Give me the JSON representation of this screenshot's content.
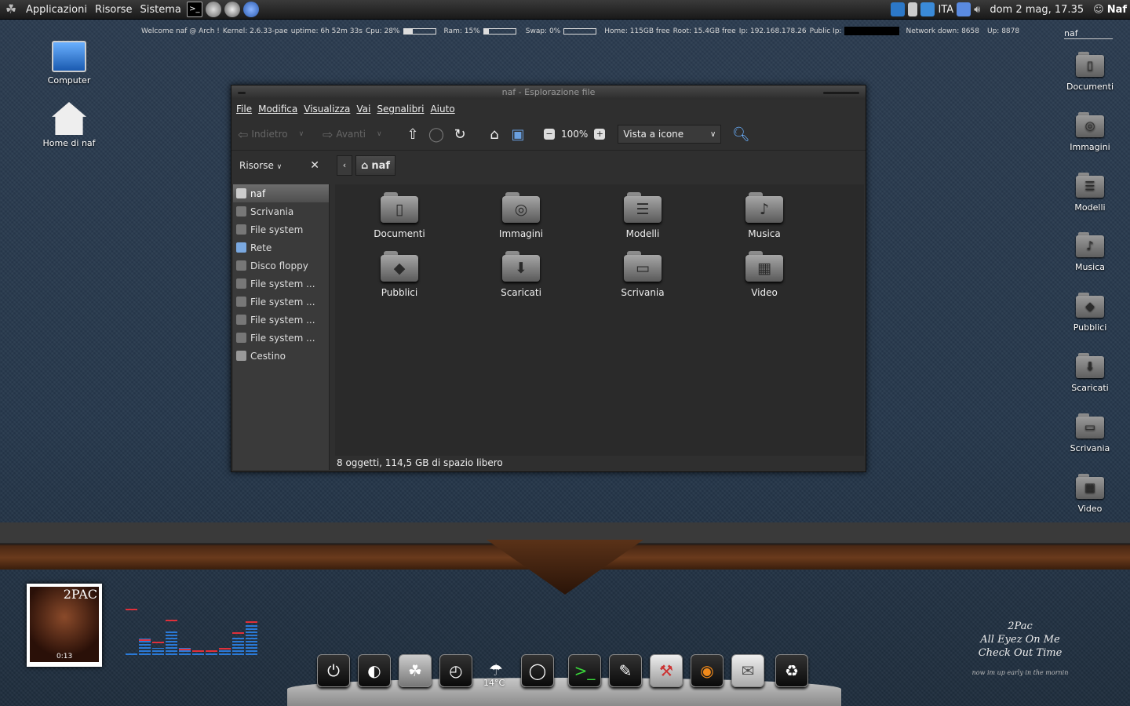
{
  "top_panel": {
    "menus": [
      "Applicazioni",
      "Risorse",
      "Sistema"
    ],
    "keyboard": "ITA",
    "clock": "dom  2 mag, 17.35",
    "user": "Naf"
  },
  "conky": {
    "welcome": "Welcome naf @ Arch !",
    "kernel": "Kernel: 2.6.33-pae",
    "uptime": "uptime: 6h 52m 33s",
    "cpu": "Cpu: 28%",
    "cpu_pct": 0.28,
    "ram": "Ram: 15%",
    "ram_pct": 0.15,
    "swap": "Swap: 0%",
    "swap_pct": 0,
    "home": "Home: 115GB free",
    "root": "Root: 15.4GB free",
    "ip": "Ip: 192.168.178.26",
    "public_ip": "Public Ip:",
    "net_down": "Network down: 8658",
    "net_up": "Up: 8878",
    "user_label": "naf"
  },
  "desktop": {
    "left_icons": [
      "Computer",
      "Home di naf"
    ],
    "right_icons": [
      "Documenti",
      "Immagini",
      "Modelli",
      "Musica",
      "Pubblici",
      "Scaricati",
      "Scrivania",
      "Video"
    ]
  },
  "window": {
    "title": "naf - Esplorazione file",
    "menu": [
      "File",
      "Modifica",
      "Visualizza",
      "Vai",
      "Segnalibri",
      "Aiuto"
    ],
    "toolbar": {
      "back": "Indietro",
      "forward": "Avanti",
      "zoom": "100%",
      "view": "Vista a icone"
    },
    "sidebar_header": "Risorse",
    "breadcrumb": "naf",
    "sidebar_items": [
      "naf",
      "Scrivania",
      "File system",
      "Rete",
      "Disco floppy",
      "File system ...",
      "File system ...",
      "File system ...",
      "File system ...",
      "Cestino"
    ],
    "files": [
      "Documenti",
      "Immagini",
      "Modelli",
      "Musica",
      "Pubblici",
      "Scaricati",
      "Scrivania",
      "Video"
    ],
    "status": "8 oggetti, 114,5 GB di spazio libero"
  },
  "widgets": {
    "album_tag": "2PAC",
    "album_time": "0:13",
    "weather": "14°C",
    "eq_levels": [
      0.05,
      0.35,
      0.15,
      0.5,
      0.15,
      0.05,
      0.05,
      0.1,
      0.4,
      0.65
    ],
    "eq_peaks": [
      0.95,
      0.3,
      0.25,
      0.72,
      0.1,
      0.06,
      0.06,
      0.12,
      0.45,
      0.68
    ],
    "lyrics_title": "2Pac",
    "lyrics_line1": "All Eyez On Me",
    "lyrics_line2": "Check Out Time",
    "lyrics_small": "now im up early in the mornin"
  },
  "colors": {
    "wallpaper": "#26384c",
    "eq_bar": "#2a7ad8",
    "eq_peak": "#e0303a"
  }
}
